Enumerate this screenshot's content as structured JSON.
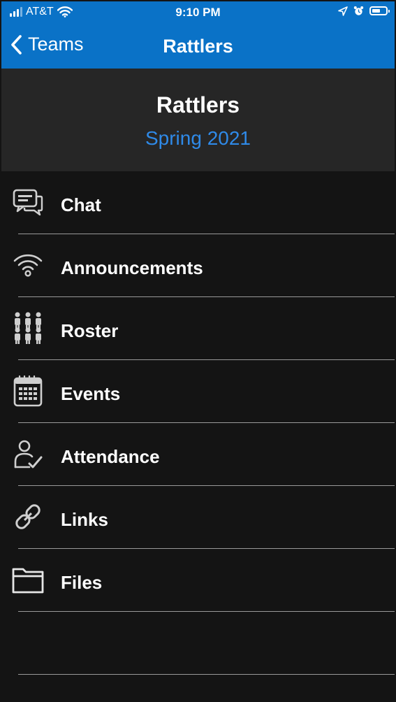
{
  "status_bar": {
    "carrier": "AT&T",
    "time": "9:10 PM"
  },
  "nav": {
    "back_label": "Teams",
    "title": "Rattlers"
  },
  "team": {
    "name": "Rattlers",
    "season": "Spring 2021"
  },
  "menu": {
    "items": [
      {
        "label": "Chat",
        "icon": "chat-icon"
      },
      {
        "label": "Announcements",
        "icon": "broadcast-icon"
      },
      {
        "label": "Roster",
        "icon": "roster-icon"
      },
      {
        "label": "Events",
        "icon": "calendar-icon"
      },
      {
        "label": "Attendance",
        "icon": "attendance-icon"
      },
      {
        "label": "Links",
        "icon": "link-icon"
      },
      {
        "label": "Files",
        "icon": "folder-icon"
      }
    ]
  },
  "colors": {
    "nav_blue": "#0a72c7",
    "season_blue": "#2f8ae8",
    "header_bg": "#262626",
    "list_bg": "#141414"
  }
}
